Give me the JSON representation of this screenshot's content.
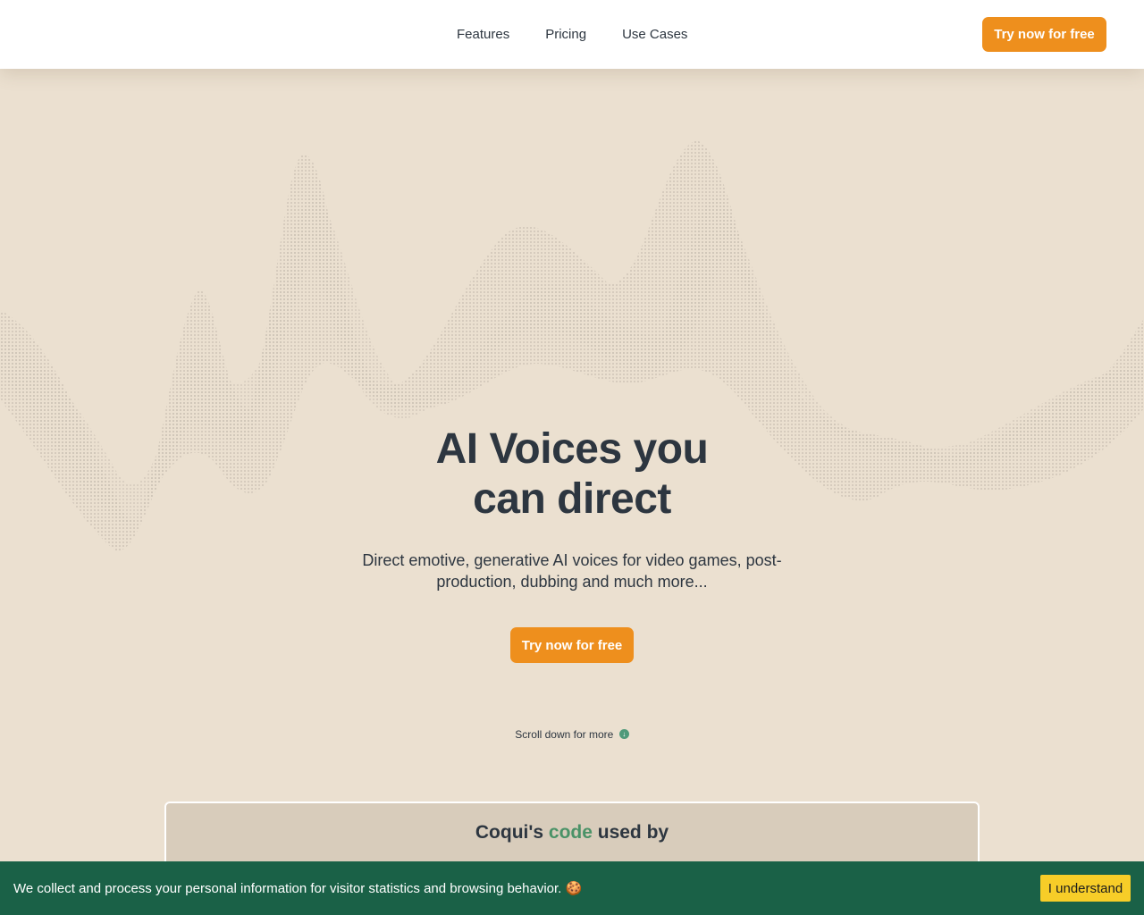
{
  "header": {
    "nav": [
      "Features",
      "Pricing",
      "Use Cases"
    ],
    "cta_label": "Try now for free"
  },
  "hero": {
    "title_line1": "AI Voices you",
    "title_line2": "can direct",
    "subtitle": "Direct emotive, generative AI voices for video games, post-production, dubbing and much more...",
    "cta_label": "Try now for free",
    "scroll_hint": "Scroll down for more"
  },
  "used_by": {
    "prefix": "Coqui's",
    "accent": "code",
    "suffix": "used by"
  },
  "cookie": {
    "text": "We collect and process your personal information for visitor statistics and browsing behavior. 🍪",
    "button_label": "I understand"
  },
  "colors": {
    "background": "#ebe0d0",
    "primary_orange": "#ee8f1d",
    "accent_green": "#4a9267",
    "cookie_bar": "#1a6147",
    "cookie_button": "#f7cd28"
  },
  "icons": {
    "scroll_info": "info-circle-icon",
    "decoration": "sound-wave-graphic"
  }
}
